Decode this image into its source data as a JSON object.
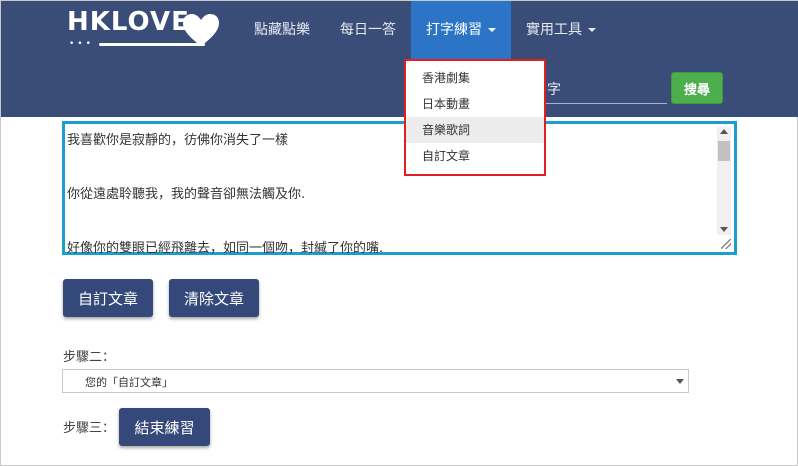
{
  "logo": {
    "text": "HKLOVE",
    "dots": "•••"
  },
  "nav": {
    "items": [
      {
        "label": "點藏點樂",
        "has_caret": false,
        "active": false
      },
      {
        "label": "每日一答",
        "has_caret": false,
        "active": false
      },
      {
        "label": "打字練習",
        "has_caret": true,
        "active": true
      },
      {
        "label": "實用工具",
        "has_caret": true,
        "active": false
      }
    ]
  },
  "search": {
    "partial_text": "字",
    "button_label": "搜尋"
  },
  "dropdown": {
    "items": [
      "香港劇集",
      "日本動畫",
      "音樂歌詞",
      "自訂文章"
    ],
    "hovered_index": 2
  },
  "editor": {
    "lines": [
      "我喜歡你是寂靜的，彷佛你消失了一樣",
      "你從遠處聆聽我，我的聲音卻無法觸及你.",
      "好像你的雙眼已經飛離去，如同一個吻，封緘了你的嘴."
    ]
  },
  "buttons": {
    "custom_article": "自訂文章",
    "clear_article": "清除文章",
    "end_practice": "結束練習"
  },
  "step2": {
    "label": "步驟二：",
    "selected": "您的「自訂文章」"
  },
  "step3": {
    "label": "步驟三："
  },
  "colors": {
    "navbar": "#3a4c78",
    "active_nav": "#2c74c6",
    "search_button": "#4cae4c",
    "editor_border": "#1a9ed0",
    "highlight_border": "#e02020",
    "primary_button": "#34497a"
  }
}
